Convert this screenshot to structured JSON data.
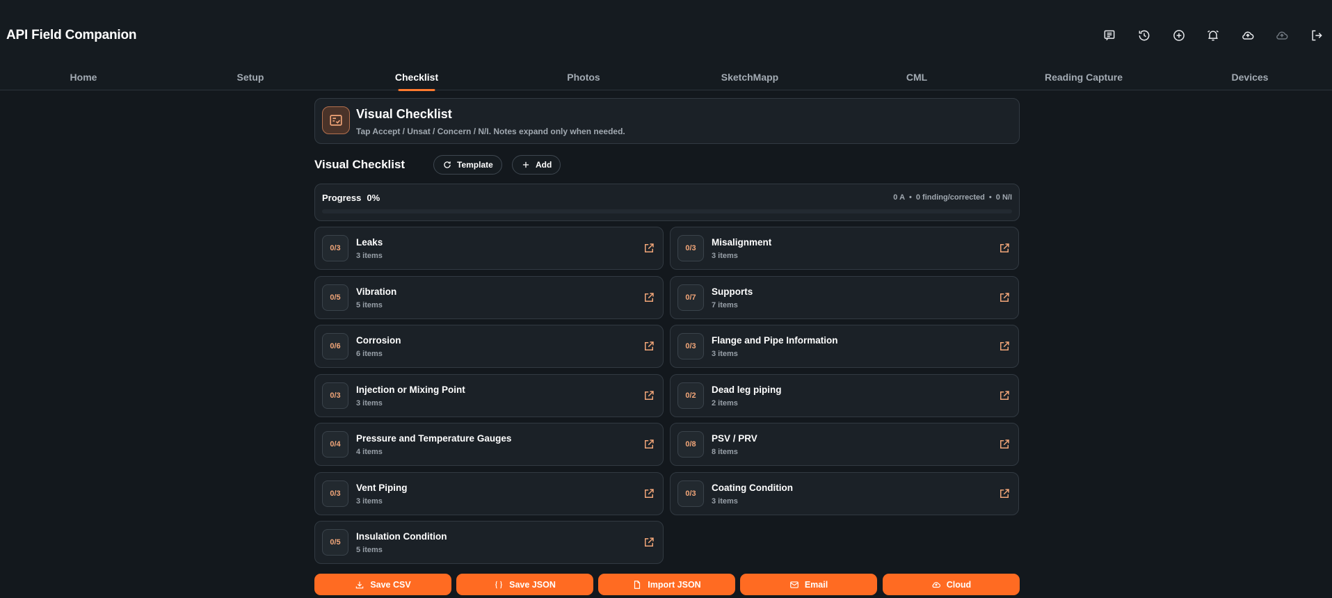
{
  "app": {
    "title": "API Field Companion"
  },
  "toolbar": {
    "icons": [
      "notes-icon",
      "history-icon",
      "add-circle-icon",
      "alarm-icon",
      "cloud-upload-icon",
      "cloud-sync-icon",
      "logout-icon"
    ]
  },
  "tabs": [
    {
      "label": "Home"
    },
    {
      "label": "Setup"
    },
    {
      "label": "Checklist",
      "active": true
    },
    {
      "label": "Photos"
    },
    {
      "label": "SketchMapp"
    },
    {
      "label": "CML"
    },
    {
      "label": "Reading Capture"
    },
    {
      "label": "Devices"
    }
  ],
  "header": {
    "title": "Visual Checklist",
    "subtitle": "Tap Accept / Unsat / Concern / N/I. Notes expand only when needed."
  },
  "section": {
    "title": "Visual Checklist",
    "template_label": "Template",
    "add_label": "Add"
  },
  "progress": {
    "label": "Progress",
    "percent": "0%",
    "fraction": 0,
    "accepted": "0 A",
    "findings": "0 finding/corrected",
    "na": "0 N/I"
  },
  "categories": [
    {
      "count": "0/3",
      "name": "Leaks",
      "items": "3 items"
    },
    {
      "count": "0/3",
      "name": "Misalignment",
      "items": "3 items"
    },
    {
      "count": "0/5",
      "name": "Vibration",
      "items": "5 items"
    },
    {
      "count": "0/7",
      "name": "Supports",
      "items": "7 items"
    },
    {
      "count": "0/6",
      "name": "Corrosion",
      "items": "6 items"
    },
    {
      "count": "0/3",
      "name": "Flange and Pipe Information",
      "items": "3 items"
    },
    {
      "count": "0/3",
      "name": "Injection or Mixing Point",
      "items": "3 items"
    },
    {
      "count": "0/2",
      "name": "Dead leg piping",
      "items": "2 items"
    },
    {
      "count": "0/4",
      "name": "Pressure and Temperature Gauges",
      "items": "4 items"
    },
    {
      "count": "0/8",
      "name": "PSV / PRV",
      "items": "8 items"
    },
    {
      "count": "0/3",
      "name": "Vent Piping",
      "items": "3 items"
    },
    {
      "count": "0/3",
      "name": "Coating Condition",
      "items": "3 items"
    },
    {
      "count": "0/5",
      "name": "Insulation Condition",
      "items": "5 items"
    }
  ],
  "buttons": [
    {
      "label": "Save CSV",
      "icon": "download-icon"
    },
    {
      "label": "Save JSON",
      "icon": "braces-icon"
    },
    {
      "label": "Import JSON",
      "icon": "file-icon"
    },
    {
      "label": "Email",
      "icon": "mail-icon"
    },
    {
      "label": "Cloud",
      "icon": "cloud-upload-icon"
    }
  ],
  "colors": {
    "accent": "#ff6b22",
    "background": "#13181d",
    "card": "#1b2127",
    "count_text": "#f2a679"
  }
}
